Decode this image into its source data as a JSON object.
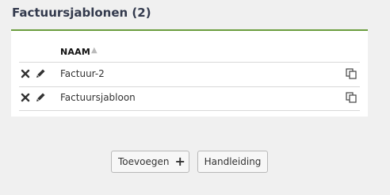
{
  "page": {
    "title": "Factuursjablonen (2)"
  },
  "table": {
    "columns": [
      {
        "label": "NAAM",
        "sort_icon": "sort-ascending-icon"
      }
    ],
    "rows": [
      {
        "name": "Factuur-2"
      },
      {
        "name": "Factuursjabloon"
      }
    ],
    "row_icons": [
      "delete-icon",
      "edit-icon",
      "copy-icon"
    ]
  },
  "actions": {
    "add_label": "Toevoegen",
    "add_icon": "plus-icon",
    "manual_label": "Handleiding"
  },
  "colors": {
    "accent": "#6b9e3f",
    "title": "#333a4d",
    "background": "#f0f0f0"
  }
}
